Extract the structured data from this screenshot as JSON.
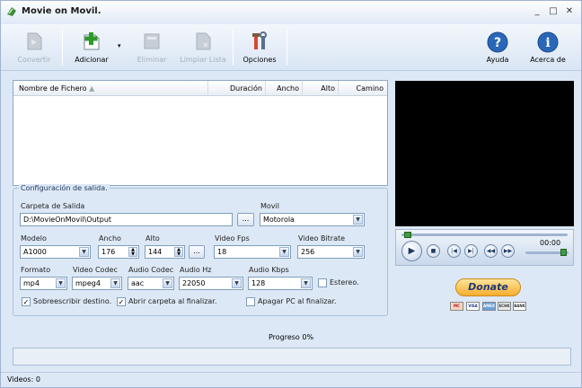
{
  "window": {
    "title": "Movie on Movil."
  },
  "toolbar": {
    "convertir": "Convertir",
    "adicionar": "Adicionar",
    "eliminar": "Eliminar",
    "limpiar": "Limpiar Lista",
    "opciones": "Opciones",
    "ayuda": "Ayuda",
    "acerca": "Acerca de"
  },
  "filelist": {
    "columns": [
      "Nombre de Fichero",
      "Duración",
      "Ancho",
      "Alto",
      "Camino"
    ]
  },
  "config": {
    "group_title": "Configuración de salida.",
    "carpeta_label": "Carpeta de Salida",
    "carpeta_value": "D:\\MovieOnMovil\\Output",
    "browse_label": "...",
    "movil_label": "Movil",
    "movil_value": "Motorola",
    "modelo_label": "Modelo",
    "modelo_value": "A1000",
    "ancho_label": "Ancho",
    "ancho_value": "176",
    "alto_label": "Alto",
    "alto_value": "144",
    "fps_label": "Video Fps",
    "fps_value": "18",
    "vbitrate_label": "Video Bitrate",
    "vbitrate_value": "256",
    "formato_label": "Formato",
    "formato_value": "mp4",
    "vcodec_label": "Video Codec",
    "vcodec_value": "mpeg4",
    "acodec_label": "Audio Codec",
    "acodec_value": "aac",
    "ahz_label": "Audio Hz",
    "ahz_value": "22050",
    "akbps_label": "Audio Kbps",
    "akbps_value": "128",
    "estereo_label": "Estereo.",
    "sobrescribir_label": "Sobreescribir destino.",
    "abrir_label": "Abrir carpeta al finalizar.",
    "apagar_label": "Apagar PC al finalizar."
  },
  "player": {
    "time": "00:00"
  },
  "donate": {
    "label": "Donate",
    "cards": [
      "MC",
      "VISA",
      "AMEX",
      "ECHK",
      "BANK"
    ]
  },
  "progress": {
    "label": "Progreso 0%",
    "value": 0
  },
  "status": {
    "videos": "Videos: 0"
  },
  "colors": {
    "accent": "#1c3a79",
    "window_bg": "#dde8f6",
    "video_bg": "#000000"
  }
}
